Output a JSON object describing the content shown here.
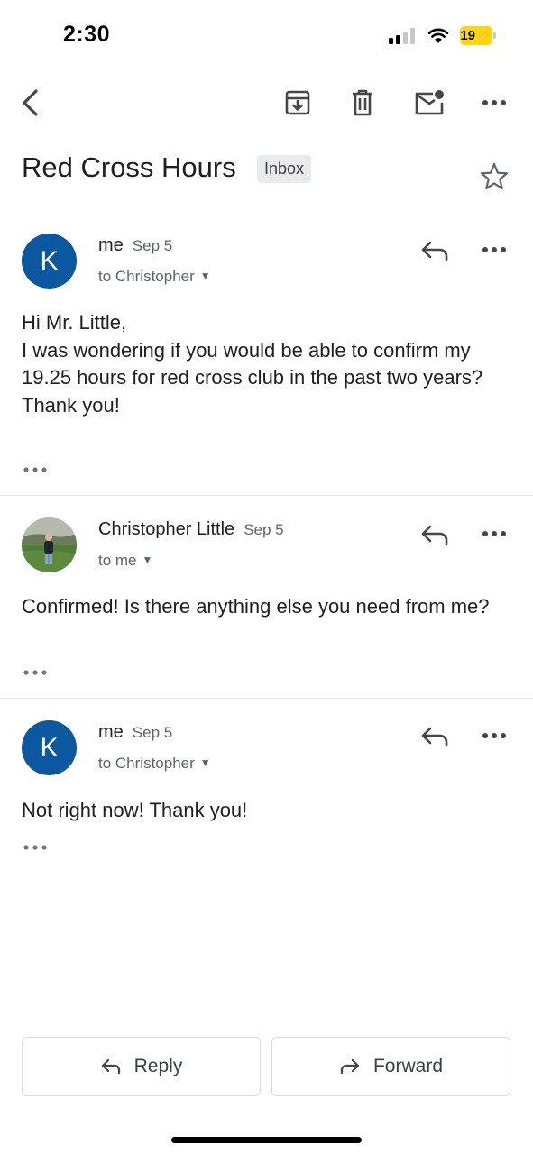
{
  "status_bar": {
    "time": "2:30",
    "battery": "19"
  },
  "toolbar": {
    "back_icon": "chevron-left-icon",
    "archive_icon": "archive-icon",
    "delete_icon": "trash-icon",
    "unread_icon": "mark-unread-icon",
    "more_icon": "more-horizontal-icon"
  },
  "thread": {
    "subject": "Red Cross Hours",
    "label": "Inbox"
  },
  "messages": [
    {
      "avatar_letter": "K",
      "sender": "me",
      "date": "Sep 5",
      "recipients": "to Christopher",
      "body": "Hi Mr. Little,\nI was wondering if you would be able to confirm my 19.25 hours for red cross club in the past two years?\nThank you!"
    },
    {
      "sender": "Christopher Little",
      "date": "Sep 5",
      "recipients": "to me",
      "body": "Confirmed! Is there anything else you need from me?"
    },
    {
      "avatar_letter": "K",
      "sender": "me",
      "date": "Sep 5",
      "recipients": "to Christopher",
      "body": "Not right now! Thank you!"
    }
  ],
  "actions": {
    "reply": "Reply",
    "forward": "Forward"
  },
  "colors": {
    "avatar": "#0b57a0",
    "battery": "#ffd60a",
    "divider": "#e3e3e3"
  }
}
